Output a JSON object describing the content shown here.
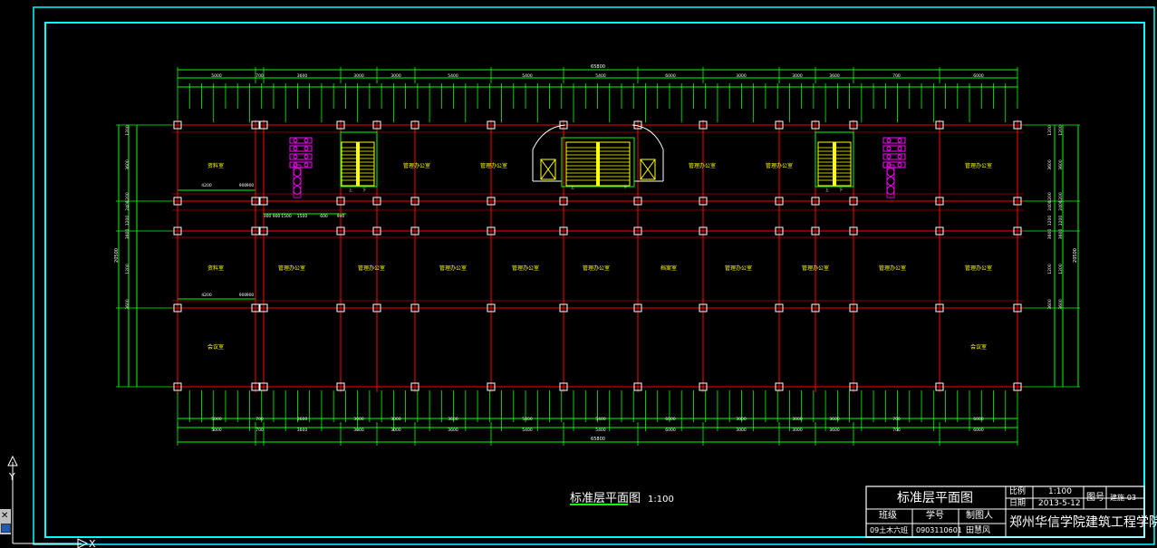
{
  "drawing": {
    "overall_length": "65800",
    "overall_depth": "20500",
    "bays_top": [
      "5000",
      "700",
      "3600",
      "3000",
      "3000",
      "5400",
      "5400",
      "5400",
      "6000",
      "3000",
      "3000",
      "3600",
      "700",
      "6000"
    ],
    "bays_bottom": [
      "5000",
      "700",
      "3600",
      "3000",
      "3000",
      "3600",
      "5400",
      "5400",
      "6000",
      "3000",
      "3000",
      "3600",
      "700",
      "6000"
    ],
    "depths_left": [
      "1200",
      "3600",
      "1200",
      "2400",
      "1200",
      "3600",
      "1200",
      "3600"
    ],
    "depths_right": [
      "1200",
      "3600",
      "1200",
      "2400",
      "1200",
      "3600",
      "1200",
      "3600"
    ],
    "mini_dims": [
      "900",
      "900",
      "1500",
      "1500",
      "600",
      "900"
    ],
    "local_dims": [
      "4200",
      "900",
      "900"
    ],
    "room_labels": [
      "资料室",
      "管理办公室",
      "管理办公室",
      "管理办公室",
      "管理办公室",
      "资料室",
      "管理办公室",
      "管理办公室",
      "管理办公室",
      "管理办公室",
      "管理办公室",
      "档案室",
      "管理办公室",
      "管理办公室",
      "管理办公室",
      "管理办公室",
      "管理办公室",
      "会议室",
      "会议室"
    ],
    "stair_labels": [
      "上",
      "下",
      "上",
      "下",
      "上",
      "下"
    ]
  },
  "caption": {
    "title": "标准层平面图",
    "scale": "1:100"
  },
  "title_block": {
    "drawing_name": "标准层平面图",
    "scale_label": "比例",
    "scale_value": "1:100",
    "date_label": "日期",
    "date_value": "2013-5-12",
    "sheet_label": "图号",
    "sheet_value": "建施-03",
    "class_label": "班级",
    "id_label": "学号",
    "drafter_label": "制图人",
    "class_value": "09土木六班",
    "id_value": "0903110601",
    "drafter_value": "田慧风",
    "school": "郑州华信学院建筑工程学院"
  },
  "colors": {
    "frame": "#00ffff",
    "grid": "#ff0000",
    "dimension": "#00ff00",
    "column": "#ffffff",
    "stair": "#ffff00",
    "toilet": "#ff00ff",
    "text": "#ffff00"
  },
  "icons": [
    "ucs-axis-icon",
    "viewport-control-icon"
  ]
}
